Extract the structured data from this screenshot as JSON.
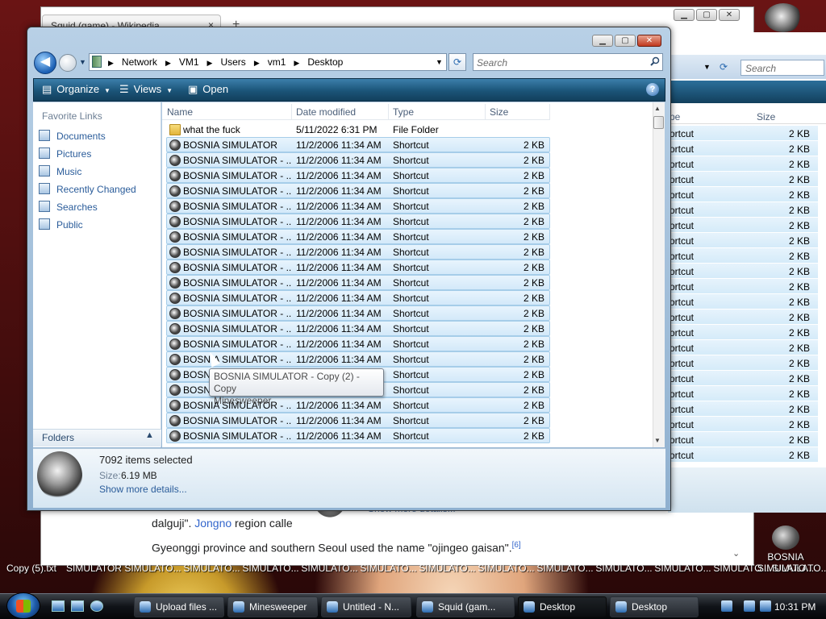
{
  "browser": {
    "tab_title": "Squid (game) - Wikipedia",
    "tab_close": "×",
    "new_tab": "+",
    "ctrl_min": "▁",
    "ctrl_max": "▢",
    "ctrl_close": "✕",
    "wiki_line1_a": "dalguji\". ",
    "wiki_line1_link": "Jongno",
    "wiki_line1_b": " region calle",
    "wiki_line2": "Gyeonggi province and southern Seoul used the name \"ojingeo gaisan\".",
    "wiki_ref": "[6]",
    "scroll_down": "⌄"
  },
  "explorer2": {
    "search_placeholder": "Search",
    "col_type": "pe",
    "col_size": "Size",
    "foot_link": "Show more details...",
    "row_type": "ortcut",
    "row_size": "2 KB",
    "row_count": 22
  },
  "desktop": {
    "strip": [
      "Copy (5).txt",
      "SIMULATOR",
      "SIMULATO...",
      "SIMULATO...",
      "SIMULATO...",
      "SIMULATO...",
      "SIMULATO...",
      "SIMULATO...",
      "SIMULATO...",
      "SIMULATO...",
      "SIMULATO...",
      "SIMULATO...",
      "SIMULATO...",
      "SIMULATO..."
    ],
    "icon_label_1": "BOSNIA",
    "icon_label_2": "SIMULATO..."
  },
  "window": {
    "ctrl_min": "▁",
    "ctrl_max": "▢",
    "ctrl_close": "✕"
  },
  "address": {
    "back": "◀",
    "history": "▼",
    "crumbs": [
      "Network",
      "VM1",
      "Users",
      "vm1",
      "Desktop"
    ],
    "crumb_sep": "▶",
    "dropdown": "▼",
    "refresh": "⟳",
    "search_placeholder": "Search"
  },
  "commands": {
    "organize": "Organize",
    "views": "Views",
    "open": "Open",
    "dropdown": "▼",
    "help": "?"
  },
  "nav": {
    "title": "Favorite Links",
    "items": [
      "Documents",
      "Pictures",
      "Music",
      "Recently Changed",
      "Searches",
      "Public"
    ],
    "folders": "Folders",
    "folders_toggle": "▲"
  },
  "columns": {
    "name": "Name",
    "date": "Date modified",
    "type": "Type",
    "size": "Size"
  },
  "files": [
    {
      "name": "what the fuck",
      "date": "5/11/2022 6:31 PM",
      "type": "File Folder",
      "size": "",
      "folder": true,
      "selected": false
    },
    {
      "name": "BOSNIA SIMULATOR",
      "date": "11/2/2006 11:34 AM",
      "type": "Shortcut",
      "size": "2 KB",
      "selected": true
    },
    {
      "name": "BOSNIA SIMULATOR - ...",
      "date": "11/2/2006 11:34 AM",
      "type": "Shortcut",
      "size": "2 KB",
      "selected": true
    },
    {
      "name": "BOSNIA SIMULATOR - ...",
      "date": "11/2/2006 11:34 AM",
      "type": "Shortcut",
      "size": "2 KB",
      "selected": true
    },
    {
      "name": "BOSNIA SIMULATOR - ...",
      "date": "11/2/2006 11:34 AM",
      "type": "Shortcut",
      "size": "2 KB",
      "selected": true
    },
    {
      "name": "BOSNIA SIMULATOR - ...",
      "date": "11/2/2006 11:34 AM",
      "type": "Shortcut",
      "size": "2 KB",
      "selected": true
    },
    {
      "name": "BOSNIA SIMULATOR - ...",
      "date": "11/2/2006 11:34 AM",
      "type": "Shortcut",
      "size": "2 KB",
      "selected": true
    },
    {
      "name": "BOSNIA SIMULATOR - ...",
      "date": "11/2/2006 11:34 AM",
      "type": "Shortcut",
      "size": "2 KB",
      "selected": true
    },
    {
      "name": "BOSNIA SIMULATOR - ...",
      "date": "11/2/2006 11:34 AM",
      "type": "Shortcut",
      "size": "2 KB",
      "selected": true
    },
    {
      "name": "BOSNIA SIMULATOR - ...",
      "date": "11/2/2006 11:34 AM",
      "type": "Shortcut",
      "size": "2 KB",
      "selected": true
    },
    {
      "name": "BOSNIA SIMULATOR - ...",
      "date": "11/2/2006 11:34 AM",
      "type": "Shortcut",
      "size": "2 KB",
      "selected": true
    },
    {
      "name": "BOSNIA SIMULATOR - ...",
      "date": "11/2/2006 11:34 AM",
      "type": "Shortcut",
      "size": "2 KB",
      "selected": true
    },
    {
      "name": "BOSNIA SIMULATOR - ...",
      "date": "11/2/2006 11:34 AM",
      "type": "Shortcut",
      "size": "2 KB",
      "selected": true
    },
    {
      "name": "BOSNIA SIMULATOR - ...",
      "date": "11/2/2006 11:34 AM",
      "type": "Shortcut",
      "size": "2 KB",
      "selected": true
    },
    {
      "name": "BOSNIA SIMULATOR - ...",
      "date": "11/2/2006 11:34 AM",
      "type": "Shortcut",
      "size": "2 KB",
      "selected": true
    },
    {
      "name": "BOSNIA SIMULATOR - ...",
      "date": "11/2/2006 11:34 AM",
      "type": "Shortcut",
      "size": "2 KB",
      "selected": true
    },
    {
      "name": "BOSNIA SIMULATOR - ...",
      "date": "11/2/2006 11:34 AM",
      "type": "Shortcut",
      "size": "2 KB",
      "selected": true
    },
    {
      "name": "BOSNIA SIMULATOR - ...",
      "date": "11/2/2006 11:34 AM",
      "type": "Shortcut",
      "size": "2 KB",
      "selected": true
    },
    {
      "name": "BOSNIA SIMULATOR - ...",
      "date": "11/2/2006 11:34 AM",
      "type": "Shortcut",
      "size": "2 KB",
      "selected": true
    },
    {
      "name": "BOSNIA SIMULATOR - ...",
      "date": "11/2/2006 11:34 AM",
      "type": "Shortcut",
      "size": "2 KB",
      "selected": true
    },
    {
      "name": "BOSNIA SIMULATOR - ...",
      "date": "11/2/2006 11:34 AM",
      "type": "Shortcut",
      "size": "2 KB",
      "selected": true
    }
  ],
  "tooltip": {
    "line1": "BOSNIA SIMULATOR - Copy (2) - Copy",
    "line2": "Minesweeper"
  },
  "scrollbar": {
    "up": "▲",
    "down": "▼"
  },
  "details": {
    "count": "7092 items selected",
    "size_label": "Size:",
    "size_value": "6.19 MB",
    "more": "Show more details..."
  },
  "taskbar": {
    "buttons": [
      {
        "label": "Upload files ...",
        "active": false
      },
      {
        "label": "Minesweeper",
        "active": false
      },
      {
        "label": "Untitled - N...",
        "active": false
      },
      {
        "label": "Squid (gam...",
        "active": false
      },
      {
        "label": "Desktop",
        "active": true
      },
      {
        "label": "Desktop",
        "active": false
      }
    ],
    "clock": "10:31 PM"
  }
}
